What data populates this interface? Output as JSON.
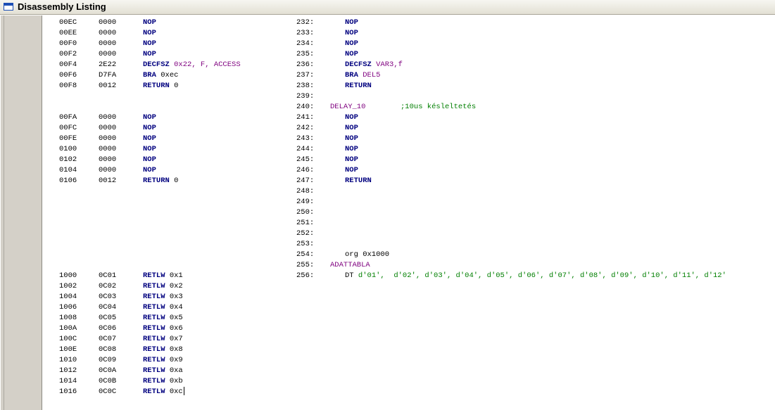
{
  "window": {
    "title": "Disassembly Listing",
    "icon": "window-icon"
  },
  "listing": [
    {
      "addr": "00EC",
      "op": "0000",
      "mnem": "NOP",
      "args": "",
      "ln": "232:",
      "src_label": "",
      "src_mnem": "NOP",
      "src_args": ""
    },
    {
      "addr": "00EE",
      "op": "0000",
      "mnem": "NOP",
      "args": "",
      "ln": "233:",
      "src_label": "",
      "src_mnem": "NOP",
      "src_args": ""
    },
    {
      "addr": "00F0",
      "op": "0000",
      "mnem": "NOP",
      "args": "",
      "ln": "234:",
      "src_label": "",
      "src_mnem": "NOP",
      "src_args": ""
    },
    {
      "addr": "00F2",
      "op": "0000",
      "mnem": "NOP",
      "args": "",
      "ln": "235:",
      "src_label": "",
      "src_mnem": "NOP",
      "src_args": ""
    },
    {
      "addr": "00F4",
      "op": "2E22",
      "mnem": "DECFSZ",
      "args": "0x22, F, ACCESS",
      "ln": "236:",
      "src_label": "",
      "src_mnem": "DECFSZ",
      "src_args": "VAR3,f"
    },
    {
      "addr": "00F6",
      "op": "D7FA",
      "mnem": "BRA",
      "args": "0xec",
      "ln": "237:",
      "src_label": "",
      "src_mnem": "BRA",
      "src_args": "DEL5"
    },
    {
      "addr": "00F8",
      "op": "0012",
      "mnem": "RETURN",
      "args": "0",
      "ln": "238:",
      "src_label": "",
      "src_mnem": "RETURN",
      "src_args": ""
    },
    {
      "addr": "",
      "op": "",
      "mnem": "",
      "args": "",
      "ln": "239:",
      "src_label": "",
      "src_mnem": "",
      "src_args": ""
    },
    {
      "addr": "",
      "op": "",
      "mnem": "",
      "args": "",
      "ln": "240:",
      "src_label": "DELAY_10",
      "src_comment": ";10us késleltetés",
      "src_mnem": "",
      "src_args": ""
    },
    {
      "addr": "00FA",
      "op": "0000",
      "mnem": "NOP",
      "args": "",
      "ln": "241:",
      "src_label": "",
      "src_mnem": "NOP",
      "src_args": ""
    },
    {
      "addr": "00FC",
      "op": "0000",
      "mnem": "NOP",
      "args": "",
      "ln": "242:",
      "src_label": "",
      "src_mnem": "NOP",
      "src_args": ""
    },
    {
      "addr": "00FE",
      "op": "0000",
      "mnem": "NOP",
      "args": "",
      "ln": "243:",
      "src_label": "",
      "src_mnem": "NOP",
      "src_args": ""
    },
    {
      "addr": "0100",
      "op": "0000",
      "mnem": "NOP",
      "args": "",
      "ln": "244:",
      "src_label": "",
      "src_mnem": "NOP",
      "src_args": ""
    },
    {
      "addr": "0102",
      "op": "0000",
      "mnem": "NOP",
      "args": "",
      "ln": "245:",
      "src_label": "",
      "src_mnem": "NOP",
      "src_args": ""
    },
    {
      "addr": "0104",
      "op": "0000",
      "mnem": "NOP",
      "args": "",
      "ln": "246:",
      "src_label": "",
      "src_mnem": "NOP",
      "src_args": ""
    },
    {
      "addr": "0106",
      "op": "0012",
      "mnem": "RETURN",
      "args": "0",
      "ln": "247:",
      "src_label": "",
      "src_mnem": "RETURN",
      "src_args": ""
    },
    {
      "addr": "",
      "op": "",
      "mnem": "",
      "args": "",
      "ln": "248:",
      "src_label": "",
      "src_mnem": "",
      "src_args": ""
    },
    {
      "addr": "",
      "op": "",
      "mnem": "",
      "args": "",
      "ln": "249:",
      "src_label": "",
      "src_mnem": "",
      "src_args": ""
    },
    {
      "addr": "",
      "op": "",
      "mnem": "",
      "args": "",
      "ln": "250:",
      "src_label": "",
      "src_mnem": "",
      "src_args": ""
    },
    {
      "addr": "",
      "op": "",
      "mnem": "",
      "args": "",
      "ln": "251:",
      "src_label": "",
      "src_mnem": "",
      "src_args": ""
    },
    {
      "addr": "",
      "op": "",
      "mnem": "",
      "args": "",
      "ln": "252:",
      "src_label": "",
      "src_mnem": "",
      "src_args": ""
    },
    {
      "addr": "",
      "op": "",
      "mnem": "",
      "args": "",
      "ln": "253:",
      "src_label": "",
      "src_mnem": "",
      "src_args": ""
    },
    {
      "addr": "",
      "op": "",
      "mnem": "",
      "args": "",
      "ln": "254:",
      "src_label": "",
      "src_plain": "org 0x1000",
      "src_mnem": "",
      "src_args": ""
    },
    {
      "addr": "",
      "op": "",
      "mnem": "",
      "args": "",
      "ln": "255:",
      "src_label": "ADATTABLA",
      "src_mnem": "",
      "src_args": ""
    },
    {
      "addr": "1000",
      "op": "0C01",
      "mnem": "RETLW",
      "args": "0x1",
      "ln": "256:",
      "src_label": "",
      "src_dt": "DT",
      "src_dt_args": "d'01',  d'02', d'03', d'04', d'05', d'06', d'07', d'08', d'09', d'10', d'11', d'12'",
      "src_mnem": "",
      "src_args": ""
    },
    {
      "addr": "1002",
      "op": "0C02",
      "mnem": "RETLW",
      "args": "0x2",
      "ln": "",
      "src_label": "",
      "src_mnem": "",
      "src_args": ""
    },
    {
      "addr": "1004",
      "op": "0C03",
      "mnem": "RETLW",
      "args": "0x3",
      "ln": "",
      "src_label": "",
      "src_mnem": "",
      "src_args": ""
    },
    {
      "addr": "1006",
      "op": "0C04",
      "mnem": "RETLW",
      "args": "0x4",
      "ln": "",
      "src_label": "",
      "src_mnem": "",
      "src_args": ""
    },
    {
      "addr": "1008",
      "op": "0C05",
      "mnem": "RETLW",
      "args": "0x5",
      "ln": "",
      "src_label": "",
      "src_mnem": "",
      "src_args": ""
    },
    {
      "addr": "100A",
      "op": "0C06",
      "mnem": "RETLW",
      "args": "0x6",
      "ln": "",
      "src_label": "",
      "src_mnem": "",
      "src_args": ""
    },
    {
      "addr": "100C",
      "op": "0C07",
      "mnem": "RETLW",
      "args": "0x7",
      "ln": "",
      "src_label": "",
      "src_mnem": "",
      "src_args": ""
    },
    {
      "addr": "100E",
      "op": "0C08",
      "mnem": "RETLW",
      "args": "0x8",
      "ln": "",
      "src_label": "",
      "src_mnem": "",
      "src_args": ""
    },
    {
      "addr": "1010",
      "op": "0C09",
      "mnem": "RETLW",
      "args": "0x9",
      "ln": "",
      "src_label": "",
      "src_mnem": "",
      "src_args": ""
    },
    {
      "addr": "1012",
      "op": "0C0A",
      "mnem": "RETLW",
      "args": "0xa",
      "ln": "",
      "src_label": "",
      "src_mnem": "",
      "src_args": ""
    },
    {
      "addr": "1014",
      "op": "0C0B",
      "mnem": "RETLW",
      "args": "0xb",
      "ln": "",
      "src_label": "",
      "src_mnem": "",
      "src_args": ""
    },
    {
      "addr": "1016",
      "op": "0C0C",
      "mnem": "RETLW",
      "args": "0xc",
      "ln": "",
      "src_label": "",
      "src_mnem": "",
      "src_args": "",
      "caret": true
    }
  ],
  "colors": {
    "keyword": "#00007f",
    "symbol": "#7f007f",
    "data_literal": "#007f00",
    "gutter": "#d4d0c8",
    "titlebar": "#ece9d8"
  }
}
